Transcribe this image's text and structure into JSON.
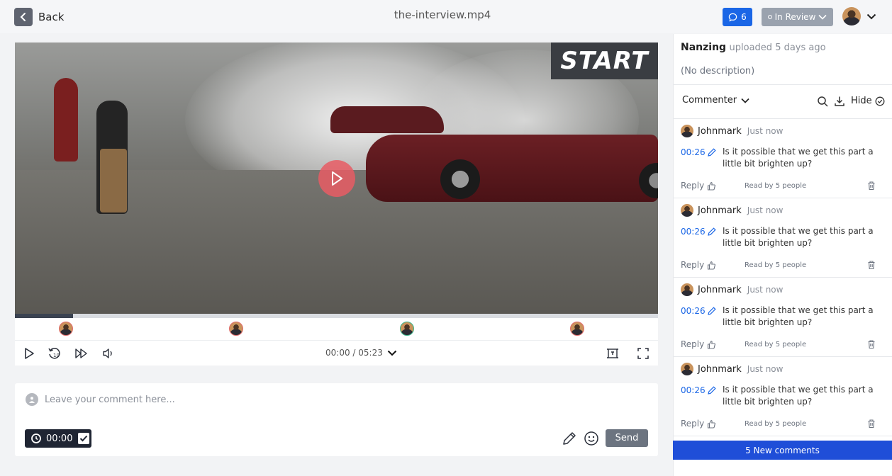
{
  "header": {
    "back_label": "Back",
    "file_title": "the-interview.mp4",
    "comment_count": "6",
    "status": "In Review"
  },
  "player": {
    "sign_text": "START",
    "progress_percent": 9,
    "current_time": "00:00",
    "duration": "05:23",
    "time_readout": "00:00 / 05:23"
  },
  "composer": {
    "placeholder": "Leave your comment here...",
    "timestamp": "00:00",
    "send_label": "Send"
  },
  "panel": {
    "uploader": "Nanzing",
    "uploaded_text": "uploaded 5 days ago",
    "description": "(No description)",
    "filter_label": "Commenter",
    "hide_label": "Hide"
  },
  "comments": [
    {
      "author": "Johnmark",
      "time": "Just now",
      "stamp": "00:26",
      "text": "Is it possible that we get this part a little bit brighten up?",
      "reply": "Reply",
      "read": "Read by 5 people"
    },
    {
      "author": "Johnmark",
      "time": "Just now",
      "stamp": "00:26",
      "text": "Is it possible that we get this part a little bit brighten up?",
      "reply": "Reply",
      "read": "Read by 5 people"
    },
    {
      "author": "Johnmark",
      "time": "Just now",
      "stamp": "00:26",
      "text": "Is it possible that we get this part a little bit brighten up?",
      "reply": "Reply",
      "read": "Read by 5 people"
    },
    {
      "author": "Johnmark",
      "time": "Just now",
      "stamp": "00:26",
      "text": "Is it possible that we get this part a little bit brighten up?",
      "reply": "Reply",
      "read": "Read by 5 people"
    }
  ],
  "new_comments_label": "5 New comments",
  "colors": {
    "accent": "#1a66e6",
    "new_comments_bar": "#1f4ed8",
    "status_pill": "#9aa2ae",
    "play_button": "#e85c64"
  },
  "icons": {
    "back": "chevron-left-icon",
    "comments": "speech-bubble-icon",
    "play": "play-icon",
    "rewind": "rewind-10-icon",
    "forward": "fast-forward-icon",
    "volume": "speaker-icon",
    "frame": "frame-icon",
    "fullscreen": "fullscreen-icon",
    "search": "search-icon",
    "download": "download-icon",
    "hide": "check-circle-icon",
    "pen": "pen-icon",
    "emoji": "emoji-icon",
    "like": "thumbs-up-icon",
    "trash": "trash-icon"
  }
}
